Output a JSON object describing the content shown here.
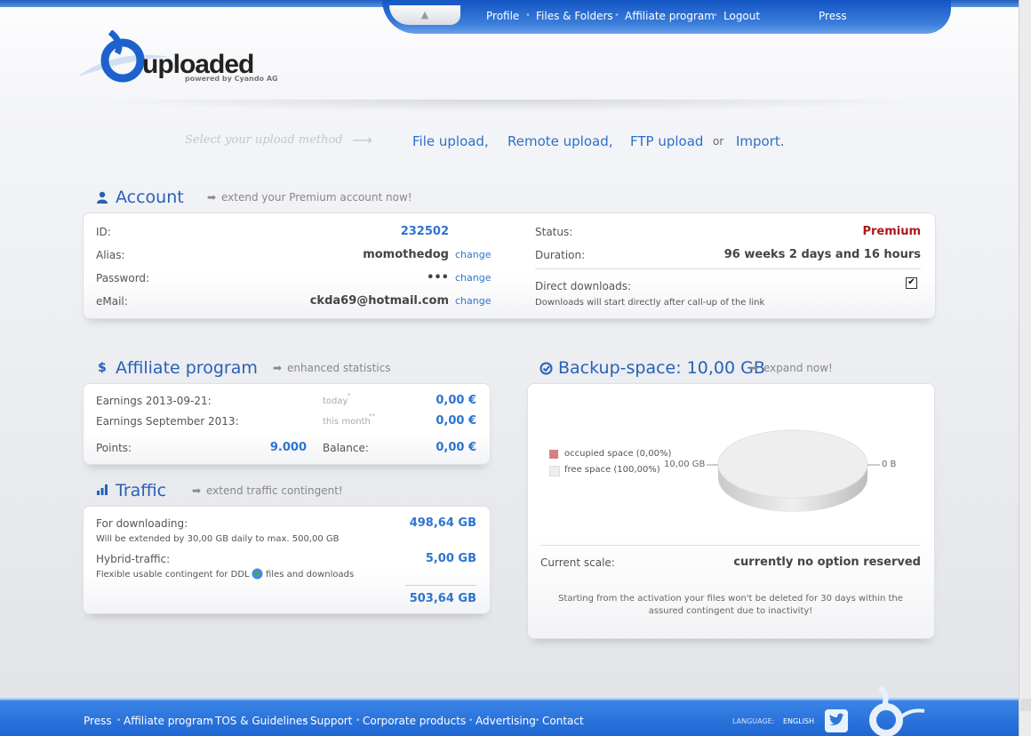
{
  "nav": {
    "up_icon": "up-arrow-icon",
    "links": [
      "Profile",
      "Files & Folders",
      "Affiliate program",
      "Logout"
    ],
    "press": "Press"
  },
  "logo": {
    "name": "uploaded",
    "sub": "powered by Cyando AG"
  },
  "upload": {
    "prompt": "Select your upload method",
    "methods": [
      "File upload,",
      "Remote upload,",
      "FTP upload"
    ],
    "or": "or",
    "import": "Import."
  },
  "account": {
    "title": "Account",
    "extend": "extend your Premium account now!",
    "id_label": "ID:",
    "id_value": "232502",
    "alias_label": "Alias:",
    "alias_value": "momothedog",
    "password_label": "Password:",
    "password_value": "•••",
    "email_label": "eMail:",
    "email_value": "ckda69@hotmail.com",
    "change": "change",
    "status_label": "Status:",
    "status_value": "Premium",
    "duration_label": "Duration:",
    "duration_value": "96 weeks 2 days and 16 hours",
    "direct_label": "Direct downloads:",
    "direct_checked": true,
    "direct_note": "Downloads will start directly after call-up of the link"
  },
  "affiliate": {
    "title": "Affiliate program",
    "link": "enhanced statistics",
    "earn_day_label": "Earnings 2013-09-21:",
    "today": "today",
    "today_mark": "*",
    "earn_day_value": "0,00 €",
    "earn_month_label": "Earnings September 2013:",
    "this_month": "this month",
    "month_mark": "**",
    "earn_month_value": "0,00 €",
    "points_label": "Points:",
    "points_value": "9.000",
    "balance_label": "Balance:",
    "balance_value": "0,00 €"
  },
  "traffic": {
    "title": "Traffic",
    "link": "extend traffic contingent!",
    "dl_label": "For downloading:",
    "dl_value": "498,64 GB",
    "dl_note": "Will be extended by 30,00 GB daily to max. 500,00 GB",
    "hybrid_label": "Hybrid-traffic:",
    "hybrid_value": "5,00 GB",
    "hybrid_note_a": "Flexible usable contingent for DDL",
    "hybrid_note_b": "files and downloads",
    "total": "503,64 GB"
  },
  "backup": {
    "title": "Backup-space: 10,00 GB",
    "link": "expand now!",
    "legend_occupied": "occupied space (0,00%)",
    "legend_free": "free space (100,00%)",
    "occupied_color": "#d88080",
    "free_color": "#eeeeee",
    "pie_left_label": "10,00 GB",
    "pie_right_label": "0 B",
    "scale_label": "Current scale:",
    "scale_value": "currently no option reserved",
    "note": "Starting from the activation your files won't be deleted for 30 days within the assured contingent due to inactivity!"
  },
  "chart_data": {
    "type": "pie",
    "categories": [
      "occupied space",
      "free space"
    ],
    "values": [
      0.0,
      100.0
    ],
    "labels": [
      "0 B",
      "10,00 GB"
    ]
  },
  "footer": {
    "links": [
      "Press",
      "Affiliate program",
      "TOS & Guidelines",
      "Support",
      "Corporate products",
      "Advertising",
      "Contact"
    ],
    "language_label": "LANGUAGE:",
    "language_value": "ENGLISH"
  }
}
